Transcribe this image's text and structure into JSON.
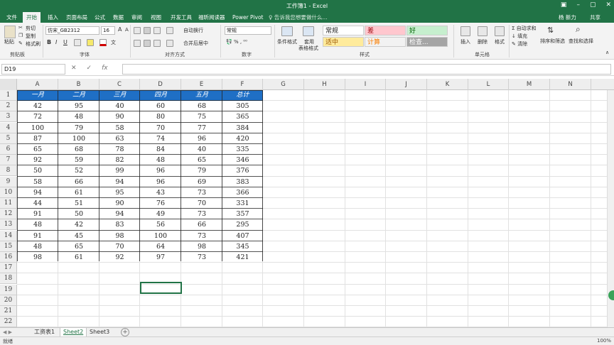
{
  "window": {
    "title": "工作簿1 - Excel",
    "user": "杨 新力",
    "share": "共享",
    "tell_me": "♀ 告诉我您想要做什么..."
  },
  "tabs": [
    "文件",
    "开始",
    "插入",
    "页面布局",
    "公式",
    "数据",
    "审阅",
    "视图",
    "开发工具",
    "福昕阅读器",
    "Power Pivot"
  ],
  "active_tab": "开始",
  "ribbon": {
    "clipboard": {
      "paste": "粘贴",
      "cut": "剪切",
      "copy": "复制",
      "format_painter": "格式刷",
      "label": "剪贴板"
    },
    "font": {
      "name": "仿宋_GB2312",
      "size": "16",
      "bold": "B",
      "italic": "I",
      "underline": "U",
      "grow": "A",
      "shrink": "A",
      "label": "字体"
    },
    "alignment": {
      "wrap": "自动换行",
      "merge": "合并后居中",
      "label": "对齐方式"
    },
    "number": {
      "format": "常规",
      "label": "数字"
    },
    "styles": {
      "conditional": "条件格式",
      "table_format": "套用",
      "table_format2": "表格格式",
      "cells": [
        "常规",
        "差",
        "好",
        "适中",
        "计算",
        "检查..."
      ],
      "label": "样式"
    },
    "cells_group": {
      "insert": "插入",
      "delete": "删除",
      "format": "格式",
      "label": "单元格"
    },
    "editing": {
      "autosum": "Σ 自动求和",
      "fill": "↓ 填充",
      "clear": "✎ 清除",
      "sort": "排序和筛选",
      "find": "查找和选择"
    }
  },
  "formula_bar": {
    "name_box": "D19",
    "fx": "fx",
    "content": ""
  },
  "columns": [
    "A",
    "B",
    "C",
    "D",
    "E",
    "F",
    "G",
    "H",
    "I",
    "J",
    "K",
    "L",
    "M",
    "N"
  ],
  "rows": [
    "1",
    "2",
    "3",
    "4",
    "5",
    "6",
    "7",
    "8",
    "9",
    "10",
    "11",
    "12",
    "13",
    "14",
    "15",
    "16",
    "17",
    "18",
    "19",
    "20",
    "21",
    "22"
  ],
  "table": {
    "headers": [
      "一月",
      "二月",
      "三月",
      "四月",
      "五月",
      "总计"
    ],
    "data": [
      [
        "42",
        "95",
        "40",
        "60",
        "68",
        "305"
      ],
      [
        "72",
        "48",
        "90",
        "80",
        "75",
        "365"
      ],
      [
        "100",
        "79",
        "58",
        "70",
        "77",
        "384"
      ],
      [
        "87",
        "100",
        "63",
        "74",
        "96",
        "420"
      ],
      [
        "65",
        "68",
        "78",
        "84",
        "40",
        "335"
      ],
      [
        "92",
        "59",
        "82",
        "48",
        "65",
        "346"
      ],
      [
        "50",
        "52",
        "99",
        "96",
        "79",
        "376"
      ],
      [
        "58",
        "66",
        "94",
        "96",
        "69",
        "383"
      ],
      [
        "94",
        "61",
        "95",
        "43",
        "73",
        "366"
      ],
      [
        "44",
        "51",
        "90",
        "76",
        "70",
        "331"
      ],
      [
        "91",
        "50",
        "94",
        "49",
        "73",
        "357"
      ],
      [
        "48",
        "42",
        "83",
        "56",
        "66",
        "295"
      ],
      [
        "91",
        "45",
        "98",
        "100",
        "73",
        "407"
      ],
      [
        "48",
        "65",
        "70",
        "64",
        "98",
        "345"
      ],
      [
        "98",
        "61",
        "92",
        "97",
        "73",
        "421"
      ]
    ]
  },
  "sheets": [
    "工资表1",
    "Sheet2",
    "Sheet3"
  ],
  "active_sheet": "Sheet2",
  "status": {
    "ready": "就绪",
    "zoom": "100%"
  },
  "colors": {
    "excel_green": "#217346",
    "header_blue": "#1f6fc5"
  }
}
